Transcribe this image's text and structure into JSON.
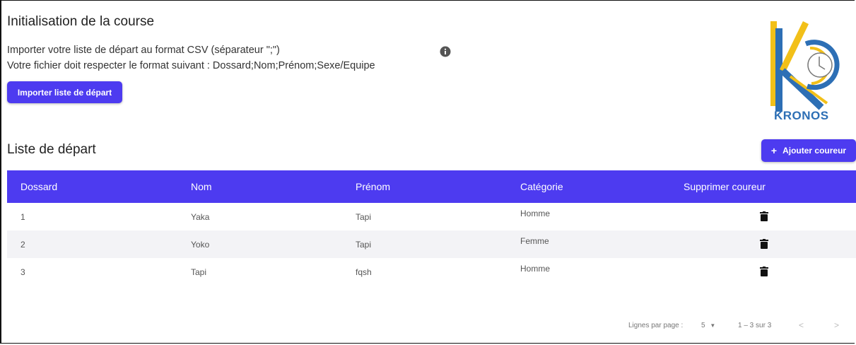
{
  "header": {
    "title": "Initialisation de la course",
    "desc_line1": "Importer votre liste de départ au format CSV (séparateur \";\")",
    "desc_line2": "Votre fichier doit respecter le format suivant : Dossard;Nom;Prénom;Sexe/Equipe",
    "import_button": "Importer liste de départ"
  },
  "logo": {
    "text": "KRONOS",
    "colors": {
      "blue": "#2d6fb5",
      "yellow": "#f2c019"
    }
  },
  "section": {
    "title": "Liste de départ",
    "add_button_icon": "+",
    "add_button": "Ajouter coureur"
  },
  "table": {
    "columns": [
      "Dossard",
      "Nom",
      "Prénom",
      "Catégorie",
      "Supprimer coureur"
    ],
    "rows": [
      {
        "dossard": "1",
        "nom": "Yaka",
        "prenom": "Tapi",
        "categorie": "Homme"
      },
      {
        "dossard": "2",
        "nom": "Yoko",
        "prenom": "Tapi",
        "categorie": "Femme"
      },
      {
        "dossard": "3",
        "nom": "Tapi",
        "prenom": "fqsh",
        "categorie": "Homme"
      }
    ],
    "delete_icon": "trash-icon"
  },
  "pagination": {
    "label": "Lignes par page :",
    "page_size": "5",
    "range": "1 – 3 sur 3",
    "prev_icon": "<",
    "next_icon": ">"
  },
  "colors": {
    "accent": "#4d3bf0",
    "row_alt": "#f3f3f6"
  }
}
